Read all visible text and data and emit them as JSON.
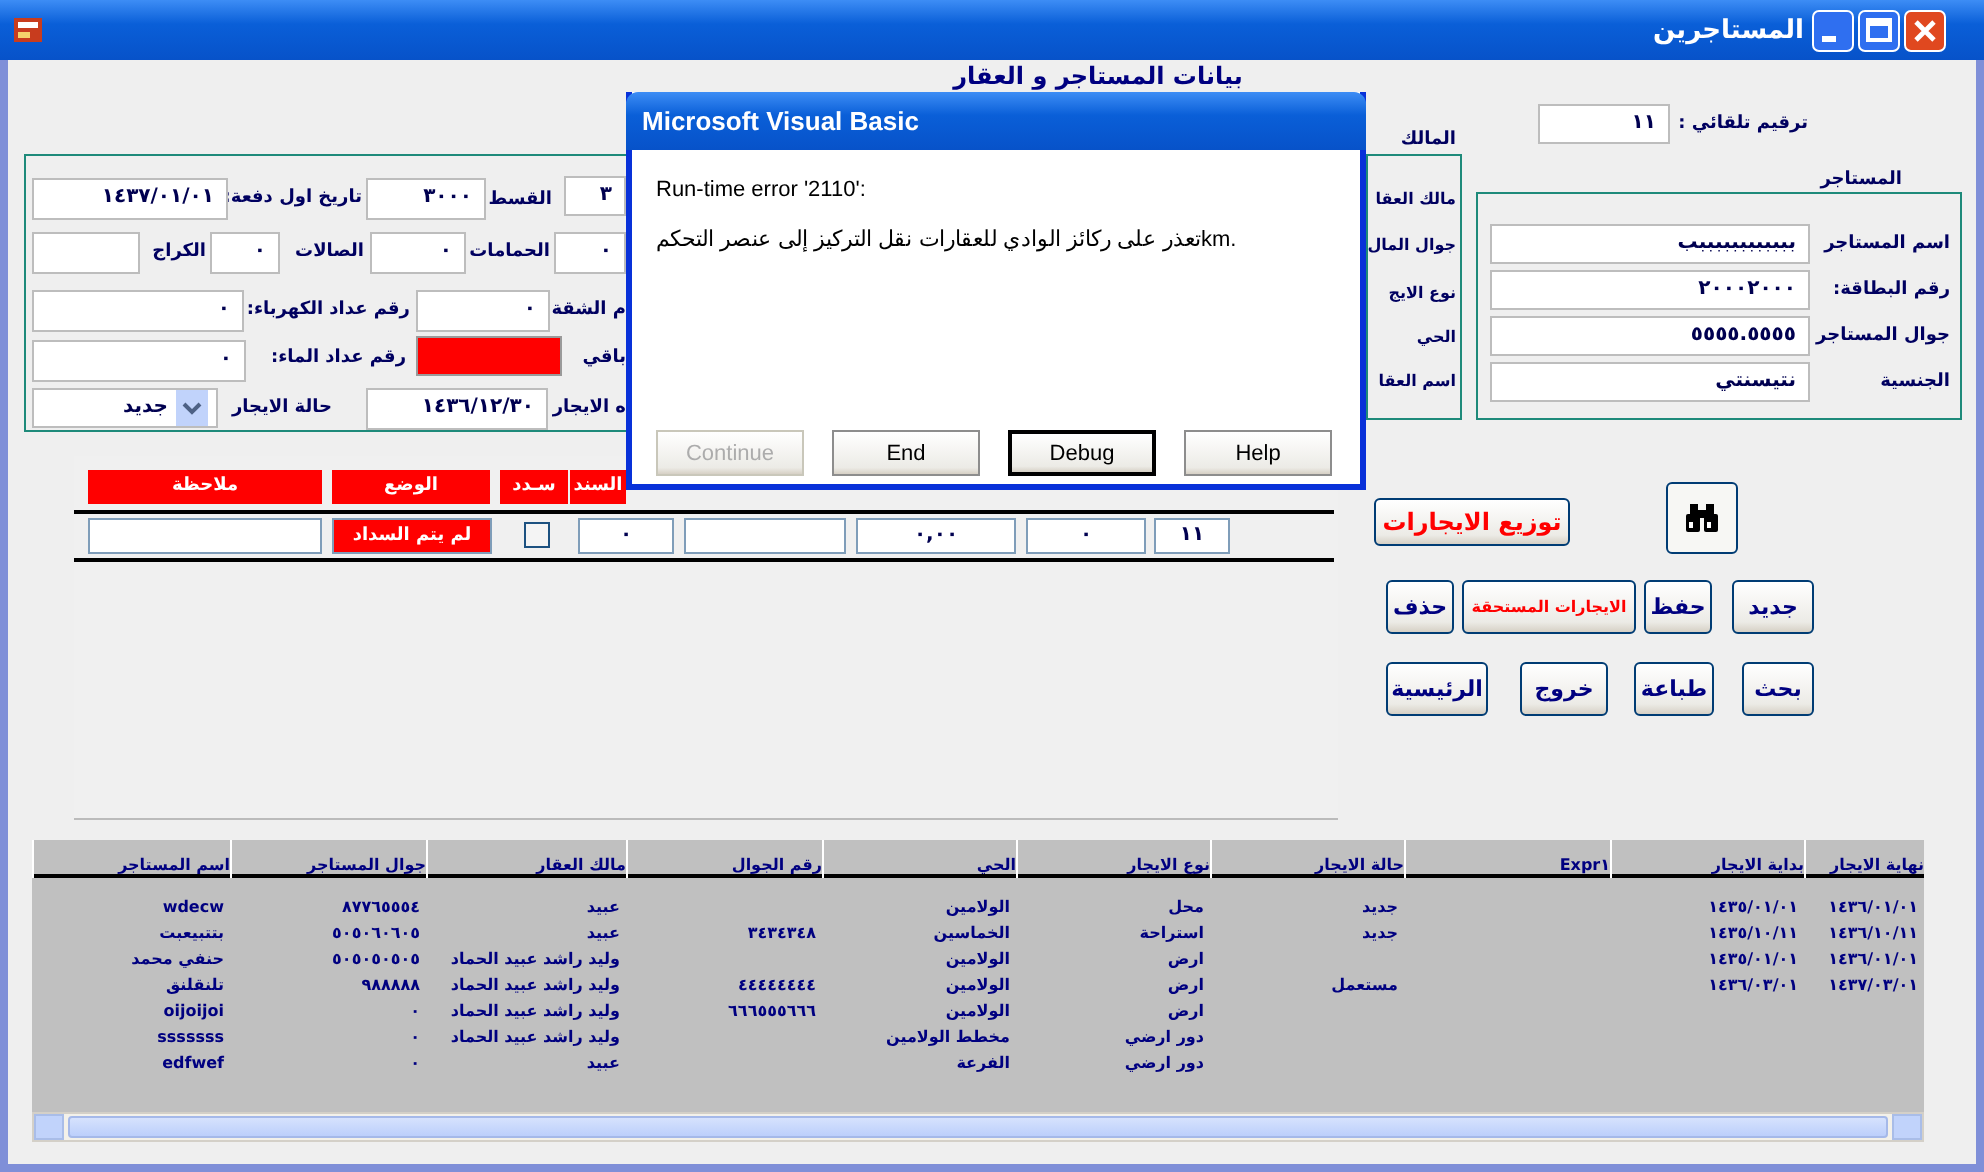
{
  "window": {
    "title": "المستاجرين"
  },
  "form_title": "بيانات المستاجر و العقار",
  "auto_number": {
    "label": "ترقيم تلقائي :",
    "value": "١١"
  },
  "contract_panel": {
    "items": [
      {
        "kind": "field",
        "value": "٣"
      },
      {
        "kind": "label",
        "text": "القسط"
      },
      {
        "kind": "field",
        "value": "٣٠٠٠"
      },
      {
        "kind": "label",
        "text": "تاريخ اول دفعة:"
      },
      {
        "kind": "field",
        "value": "١٤٣٧/٠١/٠١"
      },
      {
        "kind": "field",
        "value": "٠"
      },
      {
        "kind": "label",
        "text": "الحمامات"
      },
      {
        "kind": "field",
        "value": "٠"
      },
      {
        "kind": "label",
        "text": "الصالات"
      },
      {
        "kind": "field",
        "value": "٠"
      },
      {
        "kind": "label",
        "text": "الكراج"
      },
      {
        "kind": "field"
      },
      {
        "kind": "label",
        "text": "م الشقة"
      },
      {
        "kind": "field",
        "value": "٠"
      },
      {
        "kind": "label",
        "text": "رقم عداد الكهرباء:"
      },
      {
        "kind": "field",
        "value": "٠"
      },
      {
        "kind": "label",
        "text": "باقي"
      },
      {
        "kind": "alert"
      },
      {
        "kind": "label",
        "text": "رقم عداد الماء:"
      },
      {
        "kind": "field",
        "value": "٠"
      },
      {
        "kind": "label",
        "text": "ه الايجار"
      },
      {
        "kind": "field",
        "value": "١٤٣٦/١٢/٣٠"
      },
      {
        "kind": "label",
        "text": "حالة الايجار"
      },
      {
        "kind": "combo",
        "value": "جديد"
      }
    ]
  },
  "owner_panel": {
    "title": "المالك",
    "labels": [
      "مالك العقا",
      "جوال المال",
      "نوع الايج",
      "الحي",
      "اسم العقا"
    ]
  },
  "tenant_panel": {
    "title": "المستاجر",
    "fields": [
      {
        "label": "اسم المستاجر",
        "value": "ببببببببببببب"
      },
      {
        "label": "رقم البطاقة:",
        "value": "٢٠٠٠٢٠٠٠"
      },
      {
        "label": "جوال المستاجر",
        "value": "٥٥٥٥.٥٥٥٥"
      },
      {
        "label": "الجنسية",
        "value": "نتيسنتي"
      }
    ]
  },
  "payments_grid": {
    "columns": [
      "السند",
      "سـدد",
      "الوضع",
      "ملاحظة"
    ],
    "cells": [
      {
        "kind": "field",
        "value": "١١"
      },
      {
        "kind": "field",
        "value": "٠"
      },
      {
        "kind": "field",
        "value": "٠,٠٠"
      },
      {
        "kind": "field"
      },
      {
        "kind": "field",
        "value": "٠"
      },
      {
        "kind": "checkbox",
        "checked": false
      },
      {
        "kind": "status",
        "text": "لم يتم السداد"
      },
      {
        "kind": "field"
      }
    ]
  },
  "buttons": [
    {
      "kind": "accent",
      "label": "توزيع الايجارات"
    },
    {
      "kind": "icon"
    },
    {
      "kind": "normal",
      "label": "جديد"
    },
    {
      "kind": "normal",
      "label": "حفظ"
    },
    {
      "kind": "accent",
      "label": "الايجارات المستحقة"
    },
    {
      "kind": "normal",
      "label": "حذف"
    },
    {
      "kind": "normal",
      "label": "بحث"
    },
    {
      "kind": "normal",
      "label": "طباعة"
    },
    {
      "kind": "normal",
      "label": "خروج"
    },
    {
      "kind": "normal",
      "label": "الرئيسية"
    }
  ],
  "datasheet": {
    "columns": [
      "نهاية الايجار",
      "بداية الايجار",
      "Expr١",
      "حالة الايجار",
      "نوع الايجار",
      "الحي",
      "رقم الجوال",
      "مالك العقار",
      "جوال المستاجر",
      "اسم المستاجر"
    ],
    "rows": [
      [
        "١٤٣٦/٠١/٠١",
        "١٤٣٥/٠١/٠١",
        null,
        "جديد",
        "محل",
        "الولامين",
        null,
        "عبيد",
        "٨٧٧٦٥٥٥٤",
        "wdecw"
      ],
      [
        "١٤٣٦/١٠/١١",
        "١٤٣٥/١٠/١١",
        null,
        "جديد",
        "استراحة",
        "الخماسين",
        "٣٤٣٤٣٤٨",
        "عبيد",
        "٥٠٥٠٦٠٦٠٥",
        "بتتبيعبت"
      ],
      [
        "١٤٣٦/٠١/٠١",
        "١٤٣٥/٠١/٠١",
        null,
        null,
        "ارض",
        "الولامين",
        null,
        "وليد راشد عبيد الحماد",
        "٥٠٥٠٥٠٥٠٥",
        "حنفي محمد"
      ],
      [
        "١٤٣٧/٠٣/٠١",
        "١٤٣٦/٠٣/٠١",
        null,
        "مستعمل",
        "ارض",
        "الولامين",
        "٤٤٤٤٤٤٤٤",
        "وليد راشد عبيد الحماد",
        "٩٨٨٨٨٨",
        "تلنقلنق"
      ],
      [
        null,
        null,
        null,
        null,
        "ارض",
        "الولامين",
        "٦٦٦٥٥٥٦٦٦",
        "وليد راشد عبيد الحماد",
        "٠",
        "oijoijoi"
      ],
      [
        null,
        null,
        null,
        null,
        "دور ارضي",
        "مخطط الولامين",
        null,
        "وليد راشد عبيد الحماد",
        "٠",
        "sssssss"
      ],
      [
        null,
        null,
        null,
        null,
        "دور ارضي",
        "الفرعة",
        null,
        "عبيد",
        "٠",
        "edfwef"
      ]
    ]
  },
  "dialog": {
    "title": "Microsoft Visual Basic",
    "error": "Run-time error '2110':",
    "message": "تعذر على ركائز الوادي للعقارات نقل التركيز إلى عنصر التحكمkm.",
    "buttons": [
      {
        "label": "Help",
        "disabled": false,
        "default": false
      },
      {
        "label": "Debug",
        "disabled": false,
        "default": true
      },
      {
        "label": "End",
        "disabled": false,
        "default": false
      },
      {
        "label": "Continue",
        "disabled": true,
        "default": false
      }
    ]
  }
}
